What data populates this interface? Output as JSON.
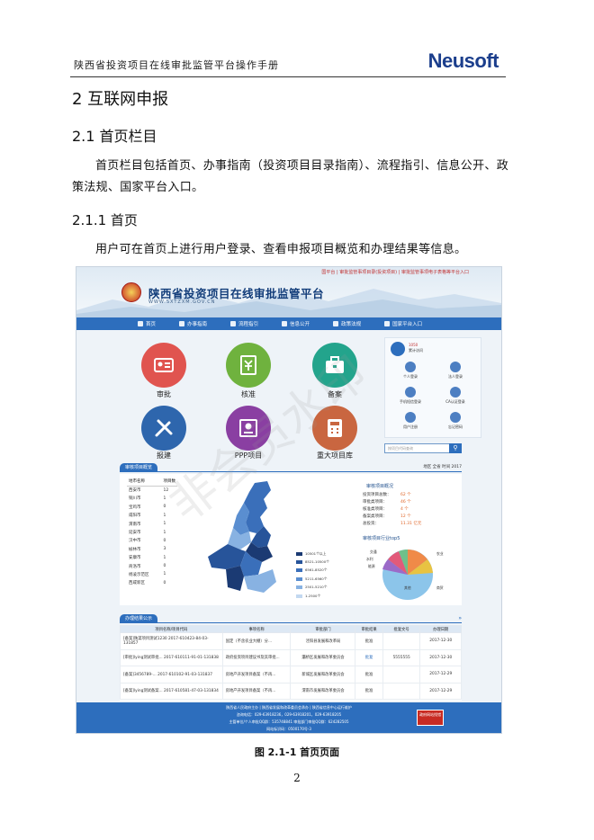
{
  "header": {
    "doc_title": "陕西省投资项目在线审批监管平台操作手册",
    "logo": "Neusoft"
  },
  "section": {
    "h1": "2 互联网申报",
    "h2": "2.1 首页栏目",
    "p1": "首页栏目包括首页、办事指南（投资项目目录指南）、流程指引、信息公开、政策法规、国家平台入口。",
    "h3": "2.1.1 首页",
    "p2": "用户可在首页上进行用户登录、查看申报项目概览和办理结果等信息。"
  },
  "screenshot": {
    "top_links": "国平台 | 审批监管事项目录(投资项目) | 审批监管事项电子表格等平台入口",
    "site_title": "陕西省投资项目在线审批监管平台",
    "site_url": "WWW.SXTZXM.GOV.CN",
    "nav": [
      "首页",
      "办事指南",
      "流程指引",
      "信息公开",
      "政策法规",
      "国家平台入口"
    ],
    "tiles": [
      {
        "label": "审批",
        "color": "#e0544f",
        "icon": "id-card-icon"
      },
      {
        "label": "核准",
        "color": "#6fb23e",
        "icon": "yuan-document-icon"
      },
      {
        "label": "备案",
        "color": "#23a48c",
        "icon": "briefcase-icon"
      },
      {
        "label": "报建",
        "color": "#2e66ad",
        "icon": "tools-icon"
      },
      {
        "label": "PPP项目",
        "color": "#8a3fa2",
        "icon": "certificate-icon"
      },
      {
        "label": "重大项目库",
        "color": "#c96640",
        "icon": "calculator-icon"
      }
    ],
    "side_panel": {
      "top_label": "1050",
      "top_sub": "累计访问",
      "items": [
        "个人登录",
        "法人登录",
        "手机短信登录",
        "CA认证登录",
        "用户注册",
        "忘记密码"
      ]
    },
    "search_placeholder": "按项目代码查询",
    "overview": {
      "tab": "审核项目概览",
      "filters": "地区  全省    时间  2017",
      "table_head": [
        "地市名称",
        "项目数"
      ],
      "rows": [
        [
          "西安市",
          "12"
        ],
        [
          "铜川市",
          "1"
        ],
        [
          "宝鸡市",
          "0"
        ],
        [
          "咸阳市",
          "1"
        ],
        [
          "渭南市",
          "1"
        ],
        [
          "延安市",
          "1"
        ],
        [
          "汉中市",
          "0"
        ],
        [
          "榆林市",
          "3"
        ],
        [
          "安康市",
          "1"
        ],
        [
          "商洛市",
          "0"
        ],
        [
          "杨凌示范区",
          "1"
        ],
        [
          "西咸新区",
          "0"
        ]
      ],
      "legend": [
        "10501个以上",
        "8521-10500个",
        "6561-8520个",
        "5211-6560个",
        "2501-5210个",
        "1-2500个"
      ],
      "legend_colors": [
        "#1b3a73",
        "#27549a",
        "#3a6fba",
        "#5a8ed0",
        "#88b2e2",
        "#c3d8f0"
      ],
      "stats_title": "审核项目概况",
      "stats": [
        [
          "投资项目总数：",
          "62 个"
        ],
        [
          "审批类项目：",
          "46 个"
        ],
        [
          "核准类项目：",
          "4 个"
        ],
        [
          "备案类项目：",
          "12 个"
        ],
        [
          "总投资：",
          "11.31 亿元"
        ]
      ],
      "pie_title": "审核项目行业top5",
      "pie_labels": [
        "交通",
        "水利",
        "能源",
        "农业",
        "其他",
        "商贸"
      ]
    },
    "results": {
      "tab": "办理结果公示",
      "headers": [
        "项目名称/项目代码",
        "事项名称",
        "审批部门",
        "审批结果",
        "批复文号",
        "办理日期"
      ],
      "rows": [
        [
          "[备案]陕菜项目测试1230 2017-610423-84-03-131857",
          "固定（不含农业大棚）分...",
          "泾阳县发展和改革局",
          "批准",
          "",
          "2017-12-30"
        ],
        [
          "[审批]lying测试审批... 2017-610111-91-01-131838",
          "政府投资项目建议书及其审批...",
          "灞桥区发展和改革委员会",
          "批复",
          "5555555",
          "2017-12-30"
        ],
        [
          "[备案]3456789-... 2017-610102-91-03-131837",
          "房地产开发项目备案（不再...",
          "新城区发展和改革委员会",
          "批准",
          "",
          "2017-12-29"
        ],
        [
          "[备案]lying测试备案... 2017-610581-47-03-131834",
          "房地产开发项目备案（不再...",
          "渭南市发展和改革委员会",
          "批准",
          "",
          "2017-12-29"
        ]
      ]
    },
    "footer": [
      "陕西省人民政府主办 | 陕西省发展和改革委员会承办 | 陕西省信息中心运行维护",
      "咨询电话：029-63918236，029-63918201，029-63918205",
      "主管单位/个人审批QQ群：535748841    审批部门审批QQ群：624282505",
      "网站标识码：0500170号-3"
    ],
    "badge": "政府网站找错",
    "watermark": "非会员水印"
  },
  "caption": "图 2.1-1  首页页面",
  "page_number": "2"
}
